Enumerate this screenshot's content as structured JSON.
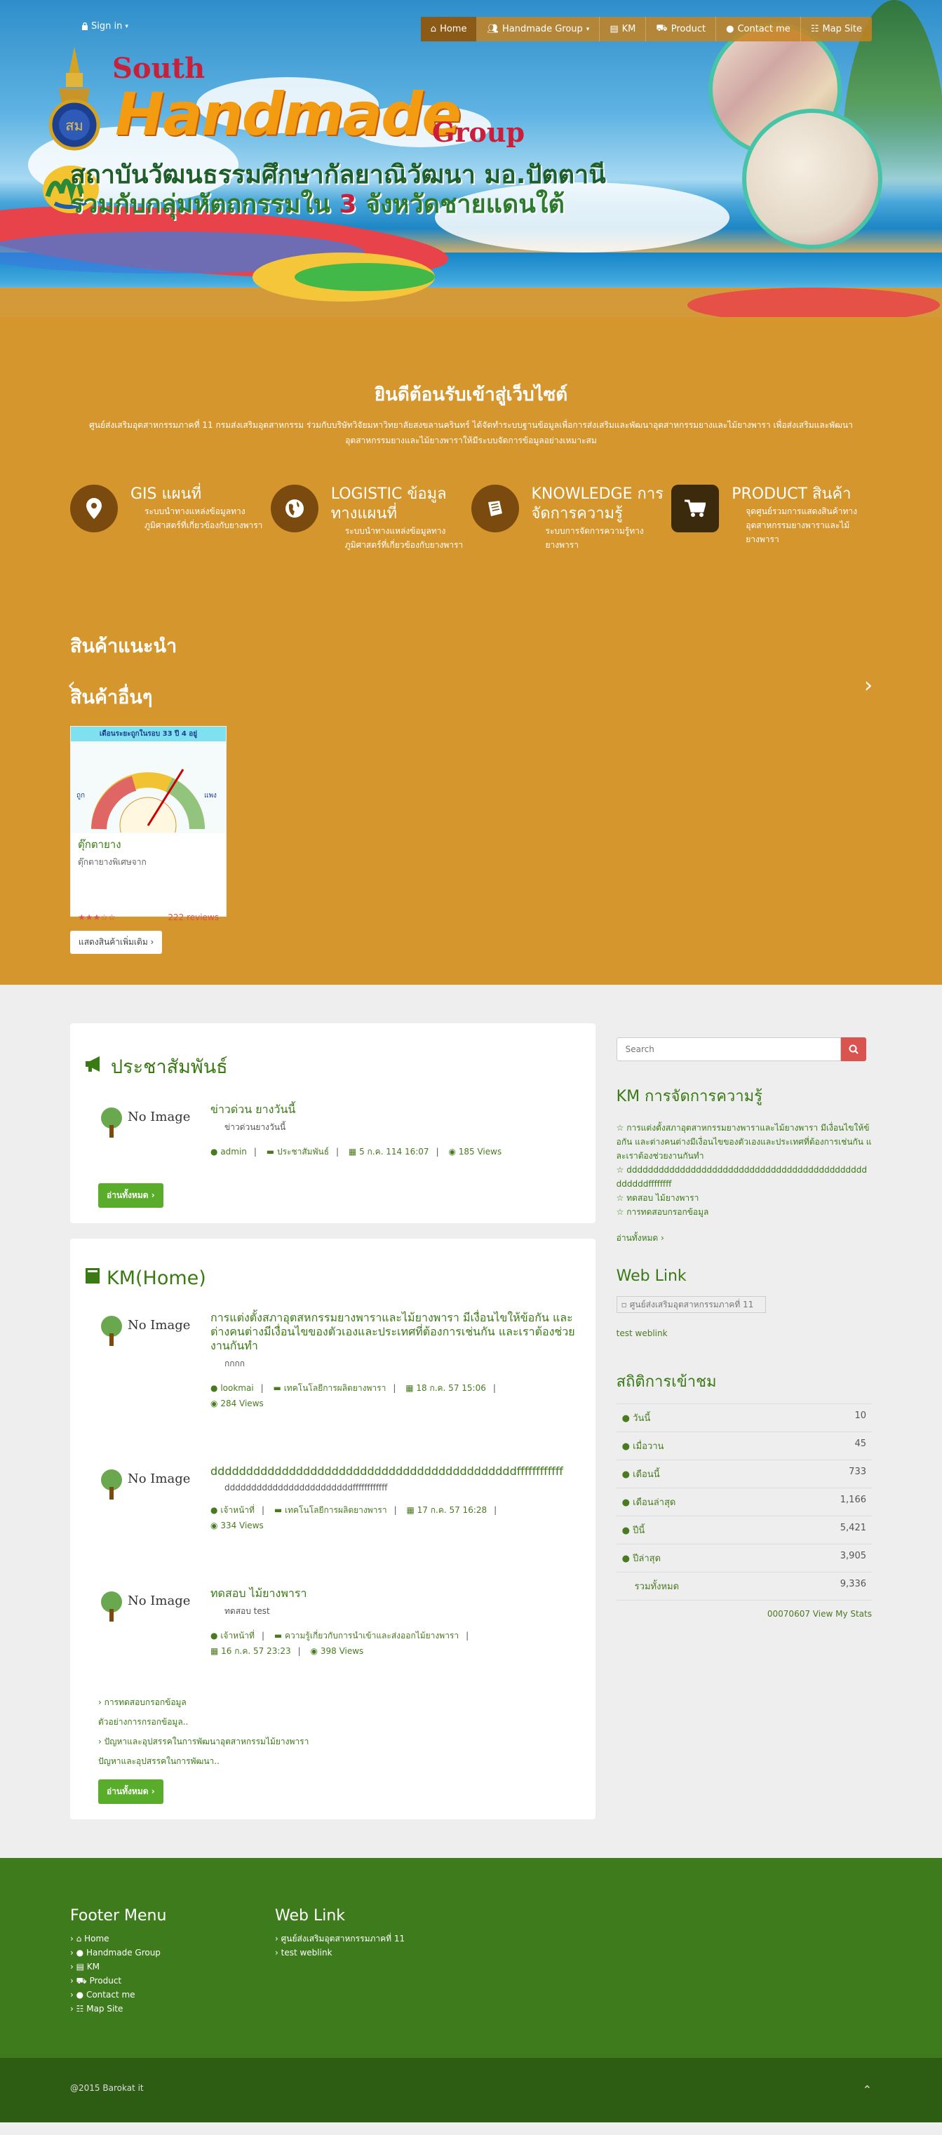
{
  "topbar": {
    "signin": "Sign in"
  },
  "nav": [
    {
      "label": "Home",
      "icon": "home-icon"
    },
    {
      "label": "Handmade Group",
      "icon": "users-icon"
    },
    {
      "label": "KM",
      "icon": "book-icon"
    },
    {
      "label": "Product",
      "icon": "cart-icon"
    },
    {
      "label": "Contact me",
      "icon": "user-icon"
    },
    {
      "label": "Map Site",
      "icon": "sitemap-icon"
    }
  ],
  "logo": {
    "south": "South",
    "handmade": "Handmade",
    "group": "Group",
    "thai_line1": "สถาบันวัฒนธรรมศึกษากัลยาณิวัฒนา มอ.ปัตตานี",
    "thai_line2_a": "ร่วมกับกลุ่มหัตถกรรมใน",
    "thai_line2_b": "3",
    "thai_line2_c": "จังหวัดชายแดนใต้"
  },
  "welcome": {
    "title": "ยินดีต้อนรับเข้าสู่เว็บไซต์",
    "desc": "ศูนย์ส่งเสริมอุตสาหกรรมภาคที่ 11 กรมส่งเสริมอุตสาหกรรม ร่วมกับบริษัทวิจัยมหาวิทยาลัยสงขลานครินทร์ ได้จัดทำระบบฐานข้อมูลเพื่อการส่งเสริมและพัฒนาอุตสาหกรรมยางและไม้ยางพารา เพื่อส่งเสริมและพัฒนาอุตสาหกรรมยางและไม้ยางพาราให้มีระบบจัดการข้อมูลอย่างเหมาะสม"
  },
  "features": [
    {
      "title": "GIS แผนที่",
      "desc": "ระบบนำทางแหล่งข้อมูลทางภูมิศาสตร์ที่เกี่ยวข้องกับยางพารา",
      "icon": "map-marker-icon"
    },
    {
      "title": "LOGISTIC ข้อมูลทางแผนที่",
      "desc": "ระบบนำทางแหล่งข้อมูลทางภูมิศาสตร์ที่เกี่ยวข้องกับยางพารา",
      "icon": "globe-icon"
    },
    {
      "title": "KNOWLEDGE การจัดการความรู้",
      "desc": "ระบบการจัดการความรู้ทางยางพารา",
      "icon": "book-icon"
    },
    {
      "title": "PRODUCT สินค้า",
      "desc": "จุดศูนย์รวมการแสดงสินค้าทางอุตสาหกรรมยางพาราและไม้ยางพารา",
      "icon": "cart-icon"
    }
  ],
  "products": {
    "recommended_title": "สินค้าแนะนำ",
    "other_title": "สินค้าอื่นๆ",
    "card": {
      "img_caption": "เดือนระยะถูกในรอบ 33 ปี 4 อยู่",
      "name": "ตุ๊กตายาง",
      "desc": "ตุ๊กตายางพิเศษจาก",
      "rating": 3,
      "reviews": "222 reviews"
    },
    "more_button": "แสดงสินค้าเพิ่มเติม"
  },
  "pr": {
    "title": "ประชาสัมพันธ์",
    "items": [
      {
        "title": "ข่าวด่วน ยางวันนี้",
        "sub": "ข่าวด่วนยางวันนี้",
        "author": "admin",
        "category": "ประชาสัมพันธ์",
        "date": "5 ก.ค. 114 16:07",
        "views": "185 Views"
      }
    ],
    "all_button": "อ่านทั้งหมด"
  },
  "km": {
    "title": "KM(Home)",
    "items": [
      {
        "title": "การแต่งตั้งสภาอุตสหกรรมยางพาราและไม้ยางพารา มีเงื่อนไขให้ข้อกัน และต่างคนต่างมีเงื่อนไขของตัวเองและประเทศที่ต้องการเช่นกัน และเราต้องช่วยงานกันทำ",
        "sub": "กกกก",
        "author": "lookmai",
        "category": "เทคโนโลยีการผลิตยางพารา",
        "date": "18 ก.ค. 57 15:06",
        "views": "284 Views"
      },
      {
        "title": "dddddddddddddddddddddddddddddddddddddddddddffffffffffff",
        "sub": "ddddddddddddddddddddddddffffffffffff",
        "author": "เจ้าหน้าที่",
        "category": "เทคโนโลยีการผลิตยางพารา",
        "date": "17 ก.ค. 57 16:28",
        "views": "334 Views"
      },
      {
        "title": "ทดสอบ ไม้ยางพารา",
        "sub": "ทดสอบ test",
        "author": "เจ้าหน้าที่",
        "category": "ความรู้เกี่ยวกับการนำเข้าและส่งออกไม้ยางพารา",
        "date": "16 ก.ค. 57 23:23",
        "views": "398 Views"
      }
    ],
    "links": [
      {
        "label": "การทดสอบกรอกข้อมูล",
        "sub": "ตัวอย่างการกรอกข้อมูล.."
      },
      {
        "label": "ปัญหาและอุปสรรคในการพัฒนาอุตสาหกรรมไม้ยางพารา",
        "sub": "ปัญหาและอุปสรรคในการพัฒนา.."
      }
    ],
    "all_button": "อ่านทั้งหมด"
  },
  "sidebar": {
    "search_placeholder": "Search",
    "km_title": "KM การจัดการความรู้",
    "km_items": [
      "การแต่งตั้งสภาอุตสาหกรรมยางพาราและไม้ยางพารา มีเงื่อนไขให้ข้อกัน และต่างคนต่างมีเงื่อนไขของตัวเองและประเทศที่ต้องการเช่นกัน และเราต้องช่วยงานกันทำ",
      "dddddddddddddddddddddddddddddddddddddddddddddddddddffffffff",
      "ทดสอบ ไม้ยางพารา",
      "การทดสอบกรอกข้อมูล"
    ],
    "km_more": "อ่านทั้งหมด",
    "weblink_title": "Web Link",
    "weblink_img_alt": "ศูนย์ส่งเสริมอุตสาหกรรมภาคที่ 11",
    "weblink_text": "test weblink",
    "stats_title": "สถิติการเข้าชม",
    "stats": [
      {
        "label": "วันนี้",
        "value": "10"
      },
      {
        "label": "เมื่อวาน",
        "value": "45"
      },
      {
        "label": "เดือนนี้",
        "value": "733"
      },
      {
        "label": "เดือนล่าสุด",
        "value": "1,166"
      },
      {
        "label": "ปีนี้",
        "value": "5,421"
      },
      {
        "label": "ปีล่าสุด",
        "value": "3,905"
      },
      {
        "label": "รวมทั้งหมด",
        "value": "9,336"
      }
    ],
    "stats_counter": "00070607",
    "stats_link": "View My Stats"
  },
  "footer": {
    "menu_title": "Footer Menu",
    "menu": [
      "Home",
      "Handmade Group",
      "KM",
      "Product",
      "Contact me",
      "Map Site"
    ],
    "weblink_title": "Web Link",
    "weblinks": [
      "ศูนย์ส่งเสริมอุตสาหกรรมภาคที่ 11",
      "test weblink"
    ],
    "copyright": "@2015 Barokat it"
  },
  "colors": {
    "accent": "#d6962e",
    "green": "#3a7a15",
    "footer": "#3e7b1d",
    "footer_dark": "#2c5d12",
    "danger": "#d9534f"
  }
}
